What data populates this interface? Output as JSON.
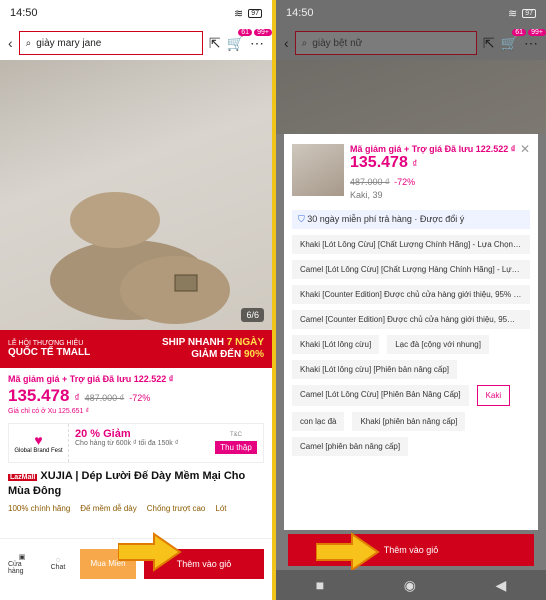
{
  "left": {
    "status_time": "14:50",
    "battery": "97",
    "search_query": "giày mary jane",
    "cart_badge": "61",
    "more_badge": "99+",
    "photo_counter": "6/6",
    "banner": {
      "left_line1": "LỄ HỘI THƯƠNG HIỆU",
      "left_line2": "QUỐC TẾ TMALL",
      "right_line1_a": "SHIP NHANH",
      "right_line1_b": "7 NGÀY",
      "right_line2_a": "GIẢM ĐẾN",
      "right_line2_b": "90%"
    },
    "promo": "Mã giảm giá + Trợ giá Đã lưu 122.522 ₫",
    "price": "135.478",
    "currency": "₫",
    "old_price": "487.000 ₫",
    "discount": "-72%",
    "xu_text": "Giá chỉ có ở Xu 125.651 ₫",
    "voucher": {
      "left_label": "Global Brand Fest",
      "title": "20 % Giảm",
      "sub": "Cho hàng từ 600k ₫ tối đa 150k ₫",
      "tc": "T&C",
      "button": "Thu thập"
    },
    "mall_tag": "LazMall",
    "title": "XUJIA | Dép Lười Đế Dày Mềm Mại Cho Mùa Đông",
    "features": [
      "100% chính hãng",
      "Đế mềm dễ dày",
      "Chống trượt cao",
      "Lót"
    ],
    "bottom": {
      "store": "Cửa hàng",
      "chat": "Chat",
      "buy_now": "Mua Miễn",
      "add_to_cart": "Thêm vào giỏ"
    }
  },
  "right": {
    "status_time": "14:50",
    "battery": "97",
    "search_query": "giày bệt nữ",
    "cart_badge": "61",
    "more_badge": "99+",
    "sheet": {
      "promo": "Mã giảm giá + Trợ giá Đã lưu 122.522 ₫",
      "price": "135.478",
      "currency": "₫",
      "old_price": "487.000 ₫",
      "discount": "-72%",
      "variant": "Kaki, 39",
      "shipping": "30 ngày miễn phí trả hàng · Được đổi ý",
      "options": [
        "Khaki [Lót Lông Cừu] [Chất Lượng Chính Hãng] - Lựa Chọn C...",
        "Camel [Lót Lông Cừu] [Chất Lượng Hàng Chính Hãng] - Lựa ...",
        "Khaki [Counter Edition] Được chủ cửa hàng giới thiệu, 95% n...",
        "Camel [Counter Edition] Được chủ cửa hàng giới thiệu, 95% ..."
      ],
      "row1": [
        "Khaki [Lót lông cừu]",
        "Lạc đà [cộng với nhung]"
      ],
      "row2": [
        "Khaki [Lót lông cừu] [Phiên bản nâng cấp]"
      ],
      "row3": [
        "Camel [Lót Lông Cừu] [Phiên Bản Nâng Cấp]",
        "Kaki"
      ],
      "row4": [
        "con lạc đà",
        "Khaki [phiên bản nâng cấp]"
      ],
      "row5": [
        "Camel [phiên bản nâng cấp]"
      ],
      "add_to_cart": "Thêm vào giỏ"
    }
  }
}
